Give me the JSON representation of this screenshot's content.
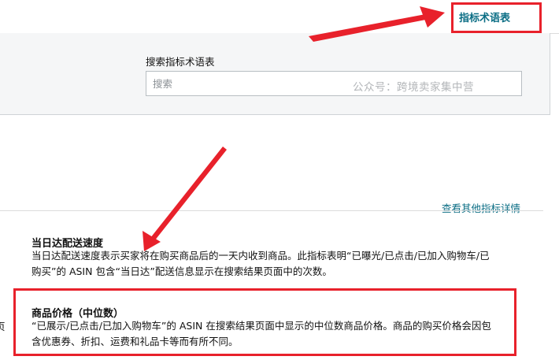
{
  "header": {
    "glossary_link": "指标术语表"
  },
  "search": {
    "label": "搜索指标术语表",
    "placeholder": "搜索",
    "watermark": "公众号：跨境卖家集中营"
  },
  "links": {
    "more_metrics": "查看其他指标详情"
  },
  "metrics": [
    {
      "title": "当日达配送速度",
      "description": "当日达配送速度表示买家将在购买商品后的一天内收到商品。此指标表明“已曝光/已点击/已加入购物车/已购买”的 ASIN 包含“当日达”配送信息显示在搜索结果页面中的次数。"
    },
    {
      "title": "商品价格（中位数）",
      "description": "“已展示/已点击/已加入购物车”的 ASIN 在搜索结果页面中显示的中位数商品价格。商品的购买价格会因包含优惠券、折扣、运费和礼品卡等而有所不同。"
    }
  ],
  "edge_text": "页",
  "colors": {
    "highlight": "#e8212b",
    "link": "#0a6d84"
  }
}
